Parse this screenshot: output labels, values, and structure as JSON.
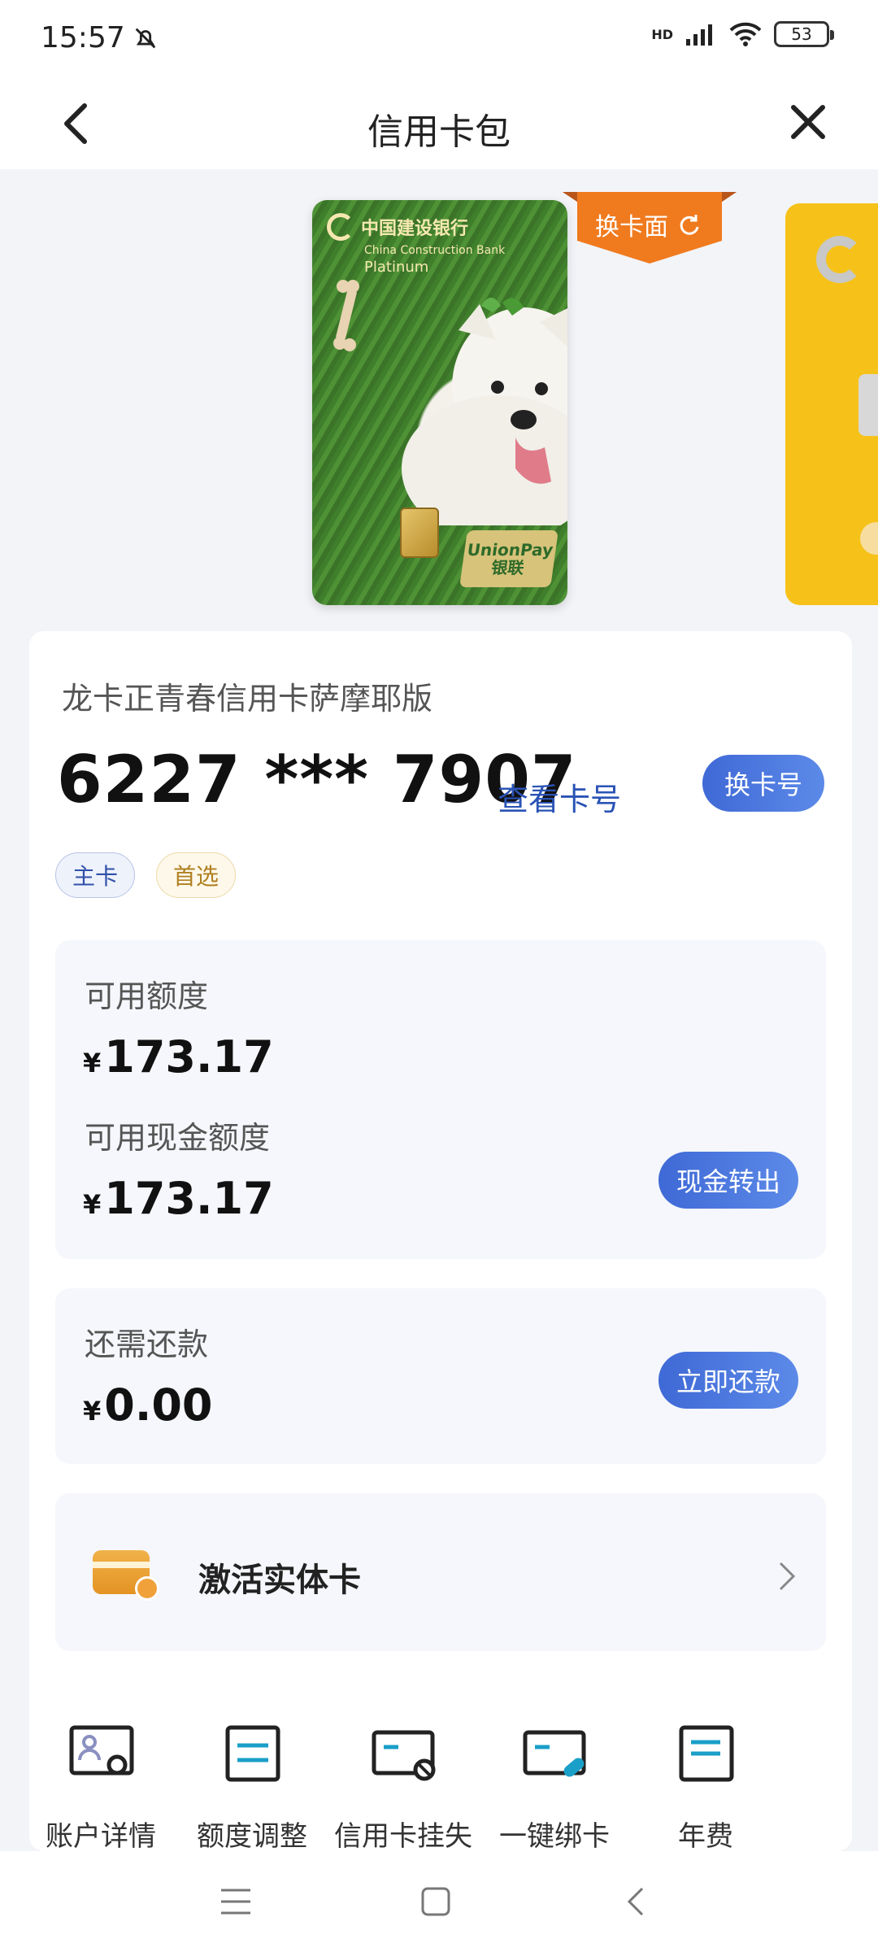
{
  "status_bar": {
    "time": "15:57",
    "network_label": "HD",
    "battery": "53",
    "icons": [
      "bell-off-icon",
      "signal-icon",
      "wifi-icon",
      "battery-icon"
    ]
  },
  "nav": {
    "title": "信用卡包",
    "back_icon": "chevron-left-icon",
    "close_icon": "close-icon"
  },
  "carousel": {
    "change_face_label": "换卡面",
    "bank_name": "中国建设银行",
    "bank_name_en": "China Construction Bank",
    "card_tier": "Platinum",
    "unionpay_en": "UnionPay",
    "unionpay_cn": "银联"
  },
  "card": {
    "name": "龙卡正青春信用卡萨摩耶版",
    "number": "6227 *** 7907",
    "view_number": "查看卡号",
    "switch_card": "换卡号",
    "tags": {
      "main": "主卡",
      "preferred": "首选"
    }
  },
  "credit": {
    "available_label": "可用额度",
    "currency": "¥",
    "available_amount": "173.17",
    "cash_label": "可用现金额度",
    "cash_amount": "173.17",
    "cash_out_button": "现金转出"
  },
  "repay": {
    "label": "还需还款",
    "amount": "0.00",
    "button": "立即还款"
  },
  "activate": {
    "label": "激活实体卡"
  },
  "tools": [
    {
      "label": "账户详情",
      "icon": "account-detail-icon"
    },
    {
      "label": "额度调整",
      "icon": "limit-adjust-icon"
    },
    {
      "label": "信用卡挂失",
      "icon": "card-report-loss-icon"
    },
    {
      "label": "一键绑卡",
      "icon": "bind-card-icon"
    },
    {
      "label": "年费",
      "icon": "annual-fee-icon"
    }
  ],
  "colors": {
    "accent": "#3f69d6",
    "link": "#2a53b5",
    "tag_main": "#3050a8",
    "tag_preferred": "#b08020",
    "face_tag": "#f07a1e",
    "tool_icon": "#1a9fc8"
  }
}
